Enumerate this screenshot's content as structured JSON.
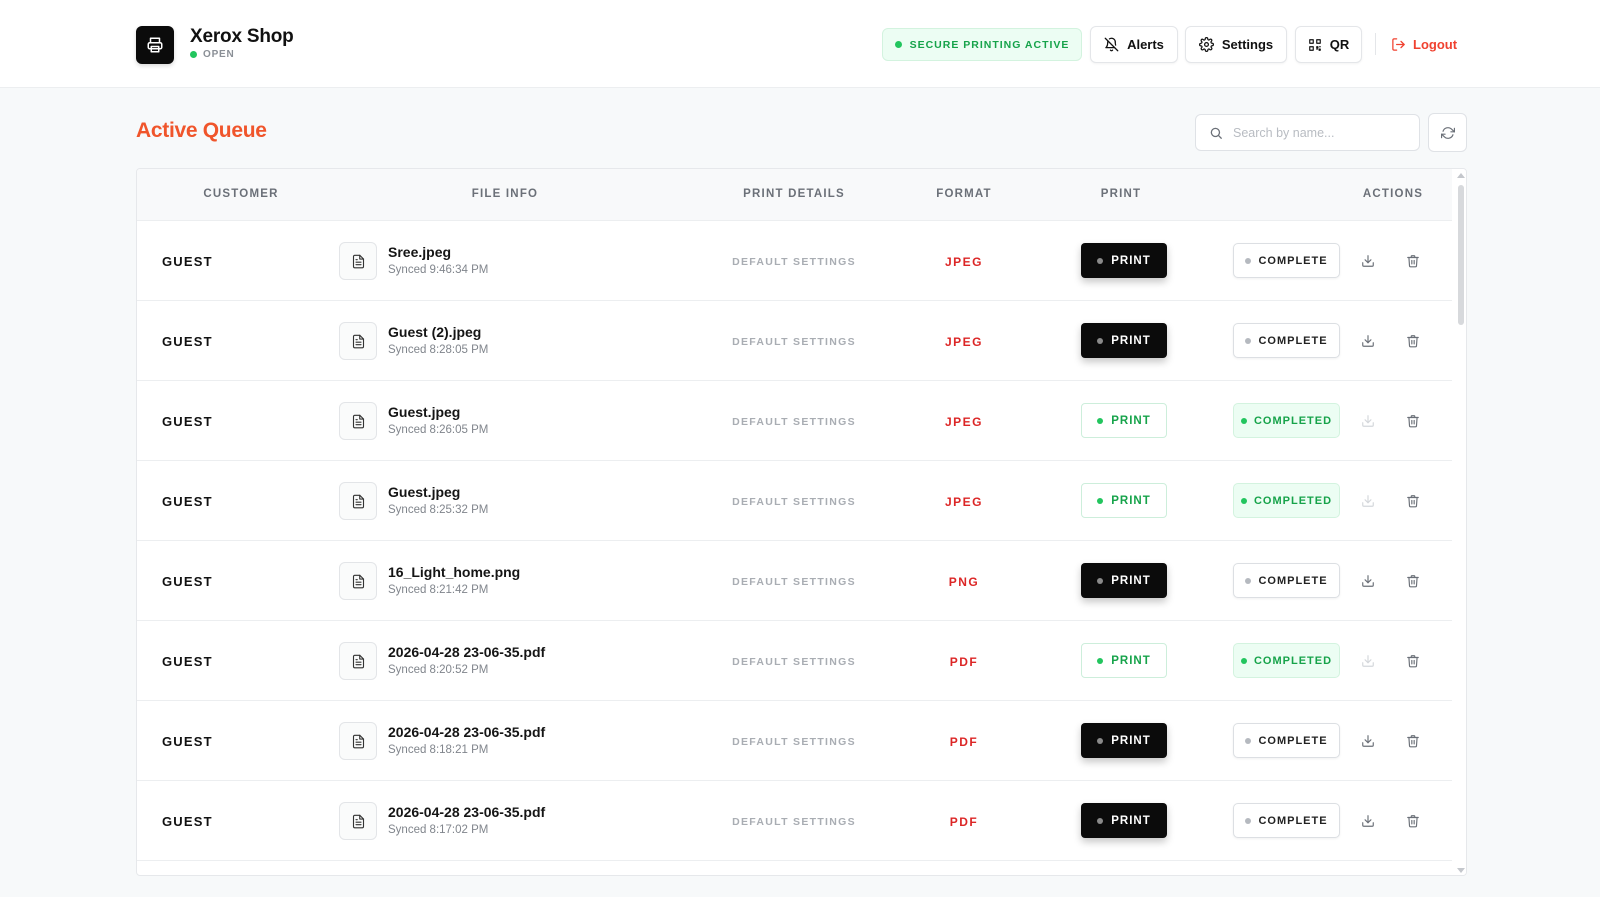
{
  "header": {
    "shop_name": "Xerox Shop",
    "shop_status": "OPEN",
    "secure_label": "SECURE PRINTING ACTIVE",
    "alerts_label": "Alerts",
    "settings_label": "Settings",
    "qr_label": "QR",
    "logout_label": "Logout"
  },
  "main": {
    "title": "Active Queue",
    "search_placeholder": "Search by name..."
  },
  "table": {
    "columns": [
      "CUSTOMER",
      "FILE INFO",
      "PRINT DETAILS",
      "FORMAT",
      "PRINT",
      "ACTIONS"
    ],
    "print_label": "PRINT",
    "complete_label": "COMPLETE",
    "completed_label": "COMPLETED",
    "rows": [
      {
        "customer": "GUEST",
        "file": "Sree.jpeg",
        "synced": "Synced 9:46:34 PM",
        "details": "DEFAULT SETTINGS",
        "format": "JPEG",
        "completed": false
      },
      {
        "customer": "GUEST",
        "file": "Guest (2).jpeg",
        "synced": "Synced 8:28:05 PM",
        "details": "DEFAULT SETTINGS",
        "format": "JPEG",
        "completed": false
      },
      {
        "customer": "GUEST",
        "file": "Guest.jpeg",
        "synced": "Synced 8:26:05 PM",
        "details": "DEFAULT SETTINGS",
        "format": "JPEG",
        "completed": true
      },
      {
        "customer": "GUEST",
        "file": "Guest.jpeg",
        "synced": "Synced 8:25:32 PM",
        "details": "DEFAULT SETTINGS",
        "format": "JPEG",
        "completed": true
      },
      {
        "customer": "GUEST",
        "file": "16_Light_home.png",
        "synced": "Synced 8:21:42 PM",
        "details": "DEFAULT SETTINGS",
        "format": "PNG",
        "completed": false
      },
      {
        "customer": "GUEST",
        "file": "2026-04-28 23-06-35.pdf",
        "synced": "Synced 8:20:52 PM",
        "details": "DEFAULT SETTINGS",
        "format": "PDF",
        "completed": true
      },
      {
        "customer": "GUEST",
        "file": "2026-04-28 23-06-35.pdf",
        "synced": "Synced 8:18:21 PM",
        "details": "DEFAULT SETTINGS",
        "format": "PDF",
        "completed": false
      },
      {
        "customer": "GUEST",
        "file": "2026-04-28 23-06-35.pdf",
        "synced": "Synced 8:17:02 PM",
        "details": "DEFAULT SETTINGS",
        "format": "PDF",
        "completed": false
      }
    ]
  },
  "colors": {
    "accent": "#f0552b",
    "success": "#16a34a",
    "format_red": "#dc2626",
    "logout_red": "#f0412f"
  },
  "icons": {
    "logo": "printer-icon",
    "alerts": "bell-off-icon",
    "settings": "gear-icon",
    "qr": "qr-code-icon",
    "logout": "logout-icon",
    "search": "search-icon",
    "refresh": "refresh-icon",
    "file": "file-text-icon",
    "download": "download-icon",
    "delete": "trash-icon"
  }
}
